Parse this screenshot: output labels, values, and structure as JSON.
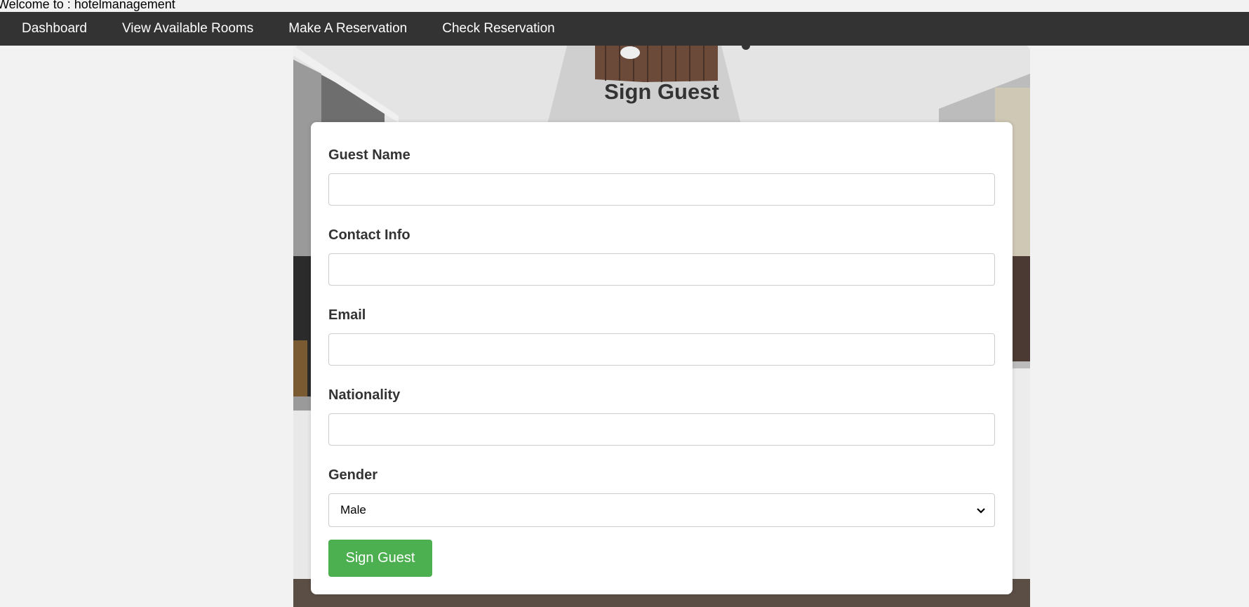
{
  "header": {
    "welcome_text": "Welcome to : hotelmanagement"
  },
  "nav": {
    "items": [
      {
        "label": "Dashboard"
      },
      {
        "label": "View Available Rooms"
      },
      {
        "label": "Make A Reservation"
      },
      {
        "label": "Check Reservation"
      }
    ]
  },
  "page": {
    "title": "Sign Guest"
  },
  "form": {
    "guest_name": {
      "label": "Guest Name",
      "value": "",
      "placeholder": ""
    },
    "contact_info": {
      "label": "Contact Info",
      "value": "",
      "placeholder": ""
    },
    "email": {
      "label": "Email",
      "value": "",
      "placeholder": ""
    },
    "nationality": {
      "label": "Nationality",
      "value": "",
      "placeholder": ""
    },
    "gender": {
      "label": "Gender",
      "selected": "Male"
    },
    "submit_label": "Sign Guest"
  },
  "colors": {
    "navbar": "#333333",
    "submit_button": "#4caf50",
    "page_background": "#f2f2f2"
  }
}
